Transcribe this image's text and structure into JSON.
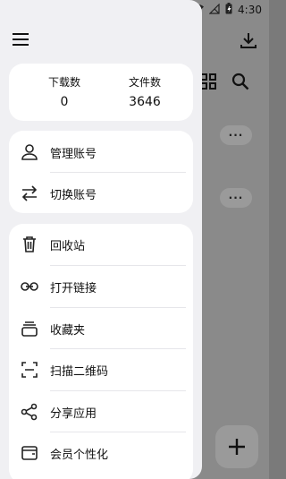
{
  "status_bar": {
    "time": "4:30"
  },
  "drawer": {
    "stats": [
      {
        "label": "下载数",
        "value": "0"
      },
      {
        "label": "文件数",
        "value": "3646"
      }
    ],
    "account_items": [
      {
        "label": "管理账号",
        "icon": "person-icon"
      },
      {
        "label": "切换账号",
        "icon": "swap-icon"
      }
    ],
    "tool_items": [
      {
        "label": "回收站",
        "icon": "trash-icon"
      },
      {
        "label": "打开链接",
        "icon": "link-icon"
      },
      {
        "label": "收藏夹",
        "icon": "collection-icon"
      },
      {
        "label": "扫描二维码",
        "icon": "scan-icon"
      },
      {
        "label": "分享应用",
        "icon": "share-icon"
      },
      {
        "label": "会员个性化",
        "icon": "wallet-icon"
      }
    ]
  },
  "background": {
    "more_label": "···"
  }
}
